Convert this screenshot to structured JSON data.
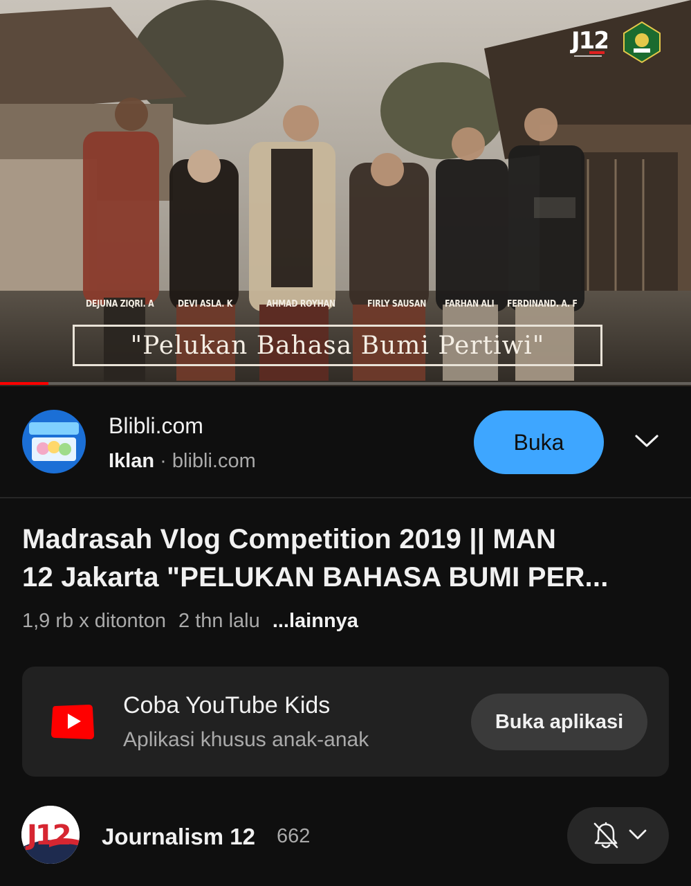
{
  "player": {
    "names": [
      "DEJUNA ZIQRI. A",
      "DEVI ASLA. K",
      "AHMAD ROYHAN",
      "FIRLY SAUSAN",
      "FARHAN ALI",
      "FERDINAND. A. F"
    ],
    "video_title_text": "\"Pelukan Bahasa Bumi Pertiwi\"",
    "logo_text": "J12",
    "progress_fraction": 0.07,
    "progress_color": "#ff0000"
  },
  "ad": {
    "advertiser": "Blibli.com",
    "label": "Iklan",
    "separator": "·",
    "domain": "blibli.com",
    "button": "Buka",
    "button_color": "#3ea6ff",
    "expand_icon": "chevron-down-icon"
  },
  "video": {
    "title_line1": "Madrasah Vlog Competition 2019 || MAN",
    "title_line2": "12 Jakarta \"PELUKAN BAHASA BUMI PER...",
    "views": "1,9 rb x ditonton",
    "age": "2 thn lalu",
    "more": "...lainnya"
  },
  "kids_promo": {
    "title": "Coba YouTube Kids",
    "subtitle": "Aplikasi khusus anak-anak",
    "button": "Buka aplikasi",
    "icon": "youtube-kids-icon"
  },
  "channel": {
    "name": "Journalism 12",
    "subscribers": "662",
    "avatar_text": "J12",
    "bell_icon": "bell-off-icon",
    "dropdown_icon": "chevron-down-icon"
  }
}
